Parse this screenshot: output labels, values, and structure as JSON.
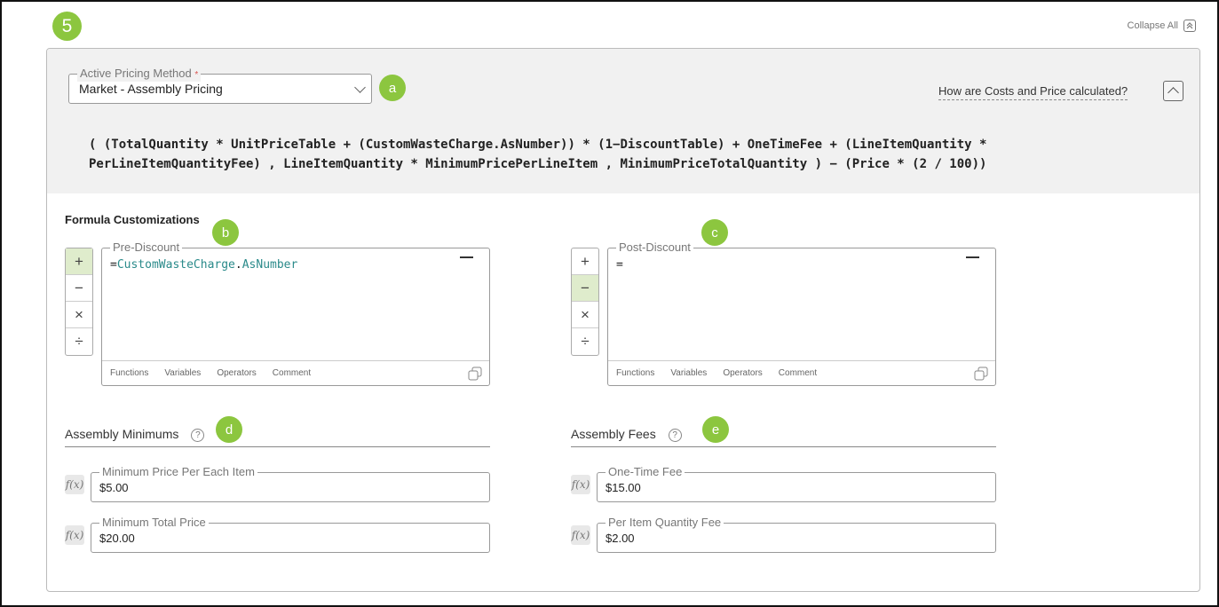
{
  "step_number": "5",
  "collapse_all": {
    "label": "Collapse All"
  },
  "pricing": {
    "label": "Active Pricing Method",
    "required_mark": "*",
    "value": "Market - Assembly Pricing",
    "marker": "a",
    "help_link": "How are Costs and Price calculated?"
  },
  "formula": {
    "line1": "( (TotalQuantity * UnitPriceTable + (CustomWasteCharge.AsNumber)) * (1−DiscountTable) + OneTimeFee + (LineItemQuantity *",
    "line2": "PerLineItemQuantityFee) , LineItemQuantity * MinimumPricePerLineItem , MinimumPriceTotalQuantity ) − (Price * (2 / 100))"
  },
  "customizations": {
    "title": "Formula Customizations",
    "operators": [
      "+",
      "−",
      "×",
      "÷"
    ],
    "footer_tabs": [
      "Functions",
      "Variables",
      "Operators",
      "Comment"
    ],
    "pre": {
      "label": "Pre-Discount",
      "marker": "b",
      "prefix": "=",
      "tok1": "CustomWasteCharge",
      "dot": ".",
      "tok2": "AsNumber"
    },
    "post": {
      "label": "Post-Discount",
      "marker": "c",
      "content": "="
    }
  },
  "minimums": {
    "title": "Assembly Minimums",
    "marker": "d",
    "fx_label": "f(x)",
    "fields": [
      {
        "label": "Minimum Price Per Each Item",
        "value": "$5.00"
      },
      {
        "label": "Minimum Total Price",
        "value": "$20.00"
      }
    ]
  },
  "fees": {
    "title": "Assembly Fees",
    "marker": "e",
    "fields": [
      {
        "label": "One-Time Fee",
        "value": "$15.00"
      },
      {
        "label": "Per Item Quantity Fee",
        "value": "$2.00"
      }
    ]
  },
  "help_glyph": "?",
  "colors": {
    "accent": "#8cc63f",
    "active_op": "#dfeccc",
    "token": "#2a8a8a"
  }
}
